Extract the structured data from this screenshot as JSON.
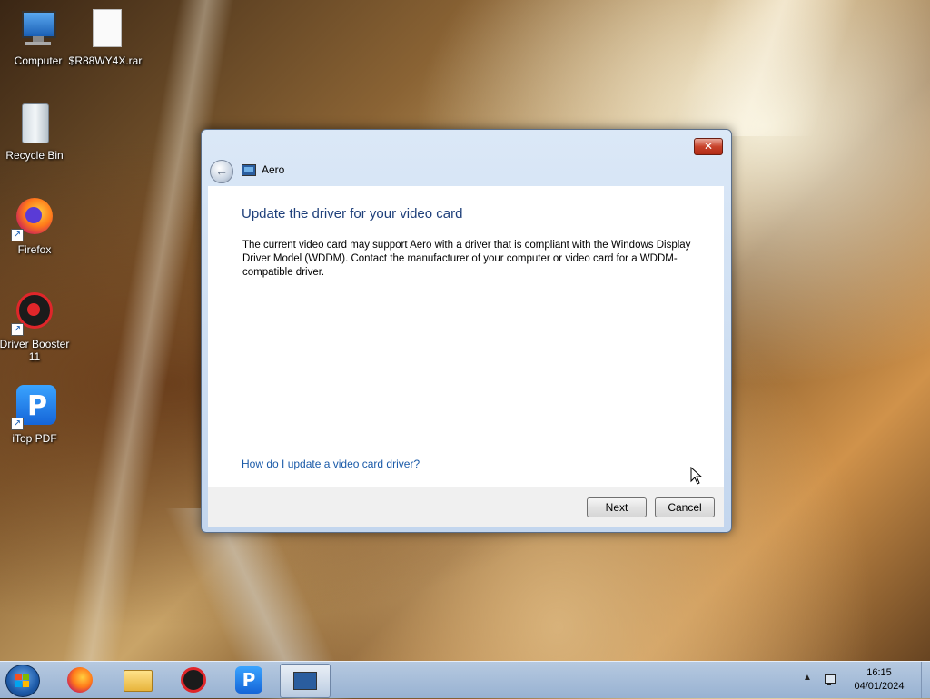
{
  "desktop": {
    "icons": [
      {
        "label": "Computer"
      },
      {
        "label": "$R88WY4X.rar"
      },
      {
        "label": "Recycle Bin"
      },
      {
        "label": "Firefox"
      },
      {
        "label": "Driver Booster 11"
      },
      {
        "label": "iTop PDF"
      }
    ]
  },
  "dialog": {
    "title": "Aero",
    "heading": "Update the driver for your video card",
    "body": "The current video card may support Aero with a driver that is compliant with the Windows Display Driver Model (WDDM).  Contact the manufacturer of your computer or video card for a WDDM-compatible driver.",
    "help_link": "How do I update a video card driver?",
    "next_label": "Next",
    "cancel_label": "Cancel",
    "close_label": "✕",
    "back_glyph": "←"
  },
  "taskbar": {
    "time": "16:15",
    "date": "04/01/2024",
    "tray_arrow": "▲",
    "items": [
      {
        "icon": "firefox-icon"
      },
      {
        "icon": "file-explorer-icon"
      },
      {
        "icon": "driver-booster-icon"
      },
      {
        "icon": "itop-pdf-icon"
      },
      {
        "icon": "aero-troubleshooter-icon"
      }
    ]
  },
  "colors": {
    "heading": "#1e3f7a",
    "link": "#1a5aa8",
    "close_button": "#c8432b"
  }
}
